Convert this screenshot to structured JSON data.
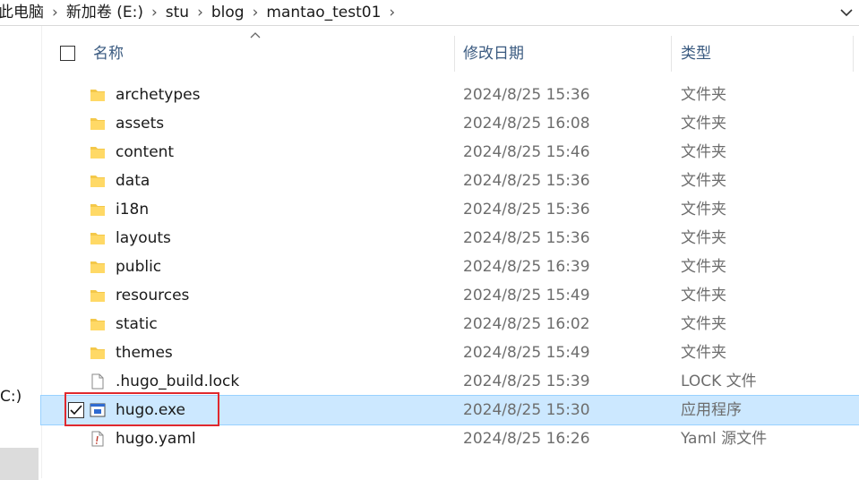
{
  "breadcrumb": [
    "此电脑",
    "新加卷 (E:)",
    "stu",
    "blog",
    "mantao_test01"
  ],
  "nav": {
    "partial_drive_label": "C:)"
  },
  "columns": {
    "name": "名称",
    "modified": "修改日期",
    "type": "类型"
  },
  "files": [
    {
      "name": "archetypes",
      "modified": "2024/8/25 15:36",
      "type": "文件夹",
      "icon": "folder-icon"
    },
    {
      "name": "assets",
      "modified": "2024/8/25 16:08",
      "type": "文件夹",
      "icon": "folder-icon"
    },
    {
      "name": "content",
      "modified": "2024/8/25 15:46",
      "type": "文件夹",
      "icon": "folder-icon"
    },
    {
      "name": "data",
      "modified": "2024/8/25 15:36",
      "type": "文件夹",
      "icon": "folder-icon"
    },
    {
      "name": "i18n",
      "modified": "2024/8/25 15:36",
      "type": "文件夹",
      "icon": "folder-icon"
    },
    {
      "name": "layouts",
      "modified": "2024/8/25 15:36",
      "type": "文件夹",
      "icon": "folder-icon"
    },
    {
      "name": "public",
      "modified": "2024/8/25 16:39",
      "type": "文件夹",
      "icon": "folder-icon"
    },
    {
      "name": "resources",
      "modified": "2024/8/25 15:49",
      "type": "文件夹",
      "icon": "folder-icon"
    },
    {
      "name": "static",
      "modified": "2024/8/25 16:02",
      "type": "文件夹",
      "icon": "folder-icon"
    },
    {
      "name": "themes",
      "modified": "2024/8/25 15:49",
      "type": "文件夹",
      "icon": "folder-icon"
    },
    {
      "name": ".hugo_build.lock",
      "modified": "2024/8/25 15:39",
      "type": "LOCK 文件",
      "icon": "blank-file-icon"
    },
    {
      "name": "hugo.exe",
      "modified": "2024/8/25 15:30",
      "type": "应用程序",
      "icon": "exe-icon",
      "selected": true
    },
    {
      "name": "hugo.yaml",
      "modified": "2024/8/25 16:26",
      "type": "Yaml 源文件",
      "icon": "yaml-file-icon"
    }
  ],
  "colors": {
    "selection_bg": "#cce8ff",
    "highlight_border": "#e0292e",
    "header_text": "#3a5a80"
  }
}
